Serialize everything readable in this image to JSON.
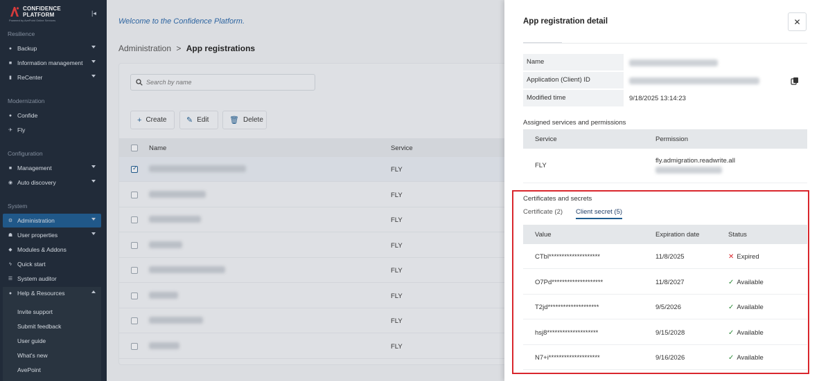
{
  "sidebar": {
    "logo_line1": "CONFIDENCE",
    "logo_line2": "PLATFORM",
    "logo_tagline": "Powered by AvePoint Online Services",
    "collapse_icon": "collapse-sidebar-icon",
    "sections": {
      "resilience": "Resilience",
      "modernization": "Modernization",
      "configuration": "Configuration",
      "system": "System"
    },
    "items": {
      "backup": "Backup",
      "information_management": "Information management",
      "recenter": "ReCenter",
      "confide": "Confide",
      "fly": "Fly",
      "management": "Management",
      "auto_discovery": "Auto discovery",
      "administration": "Administration",
      "user_properties": "User properties",
      "modules_addons": "Modules & Addons",
      "quick_start": "Quick start",
      "system_auditor": "System auditor",
      "help_resources": "Help & Resources"
    },
    "help_sub": {
      "invite_support": "Invite support",
      "submit_feedback": "Submit feedback",
      "user_guide": "User guide",
      "whats_new": "What's new",
      "avepoint": "AvePoint"
    }
  },
  "main": {
    "welcome": "Welcome to the Confidence Platform.",
    "breadcrumb_parent": "Administration",
    "breadcrumb_sep": ">",
    "breadcrumb_current": "App registrations",
    "search_placeholder": "Search by name",
    "toolbar": {
      "create": "Create",
      "edit": "Edit",
      "delete": "Delete"
    },
    "table": {
      "col_name": "Name",
      "col_service": "Service",
      "rows": [
        {
          "service": "FLY",
          "selected": true
        },
        {
          "service": "FLY",
          "selected": false
        },
        {
          "service": "FLY",
          "selected": false
        },
        {
          "service": "FLY",
          "selected": false
        },
        {
          "service": "FLY",
          "selected": false
        },
        {
          "service": "FLY",
          "selected": false
        },
        {
          "service": "FLY",
          "selected": false
        },
        {
          "service": "FLY",
          "selected": false
        }
      ]
    }
  },
  "panel": {
    "title": "App registration detail",
    "close_icon": "close-icon",
    "details": {
      "name_label": "Name",
      "client_id_label": "Application (Client) ID",
      "modified_label": "Modified time",
      "modified_value": "9/18/2025 13:14:23"
    },
    "assigned": {
      "title": "Assigned services and permissions",
      "col_service": "Service",
      "col_permission": "Permission",
      "rows": [
        {
          "service": "FLY",
          "permission": "fly.admigration.readwrite.all"
        }
      ]
    },
    "certs": {
      "title": "Certificates and secrets",
      "tab_certificate": "Certificate (2)",
      "tab_client_secret": "Client secret (5)",
      "active_tab": "client_secret",
      "col_value": "Value",
      "col_expiration": "Expiration date",
      "col_status": "Status",
      "rows": [
        {
          "value": "CTbl********************",
          "expiration": "11/8/2025",
          "status": "Expired"
        },
        {
          "value": "O7Pd********************",
          "expiration": "11/8/2027",
          "status": "Available"
        },
        {
          "value": "T2jd********************",
          "expiration": "9/5/2026",
          "status": "Available"
        },
        {
          "value": "hsj8********************",
          "expiration": "9/15/2028",
          "status": "Available"
        },
        {
          "value": "N7+i********************",
          "expiration": "9/16/2026",
          "status": "Available"
        }
      ]
    }
  },
  "colors": {
    "sidebar_bg": "#1f2a38",
    "accent": "#1e5b8f",
    "expired": "#d9262c",
    "available": "#2e8b3a",
    "highlight_box": "#d9262c"
  }
}
